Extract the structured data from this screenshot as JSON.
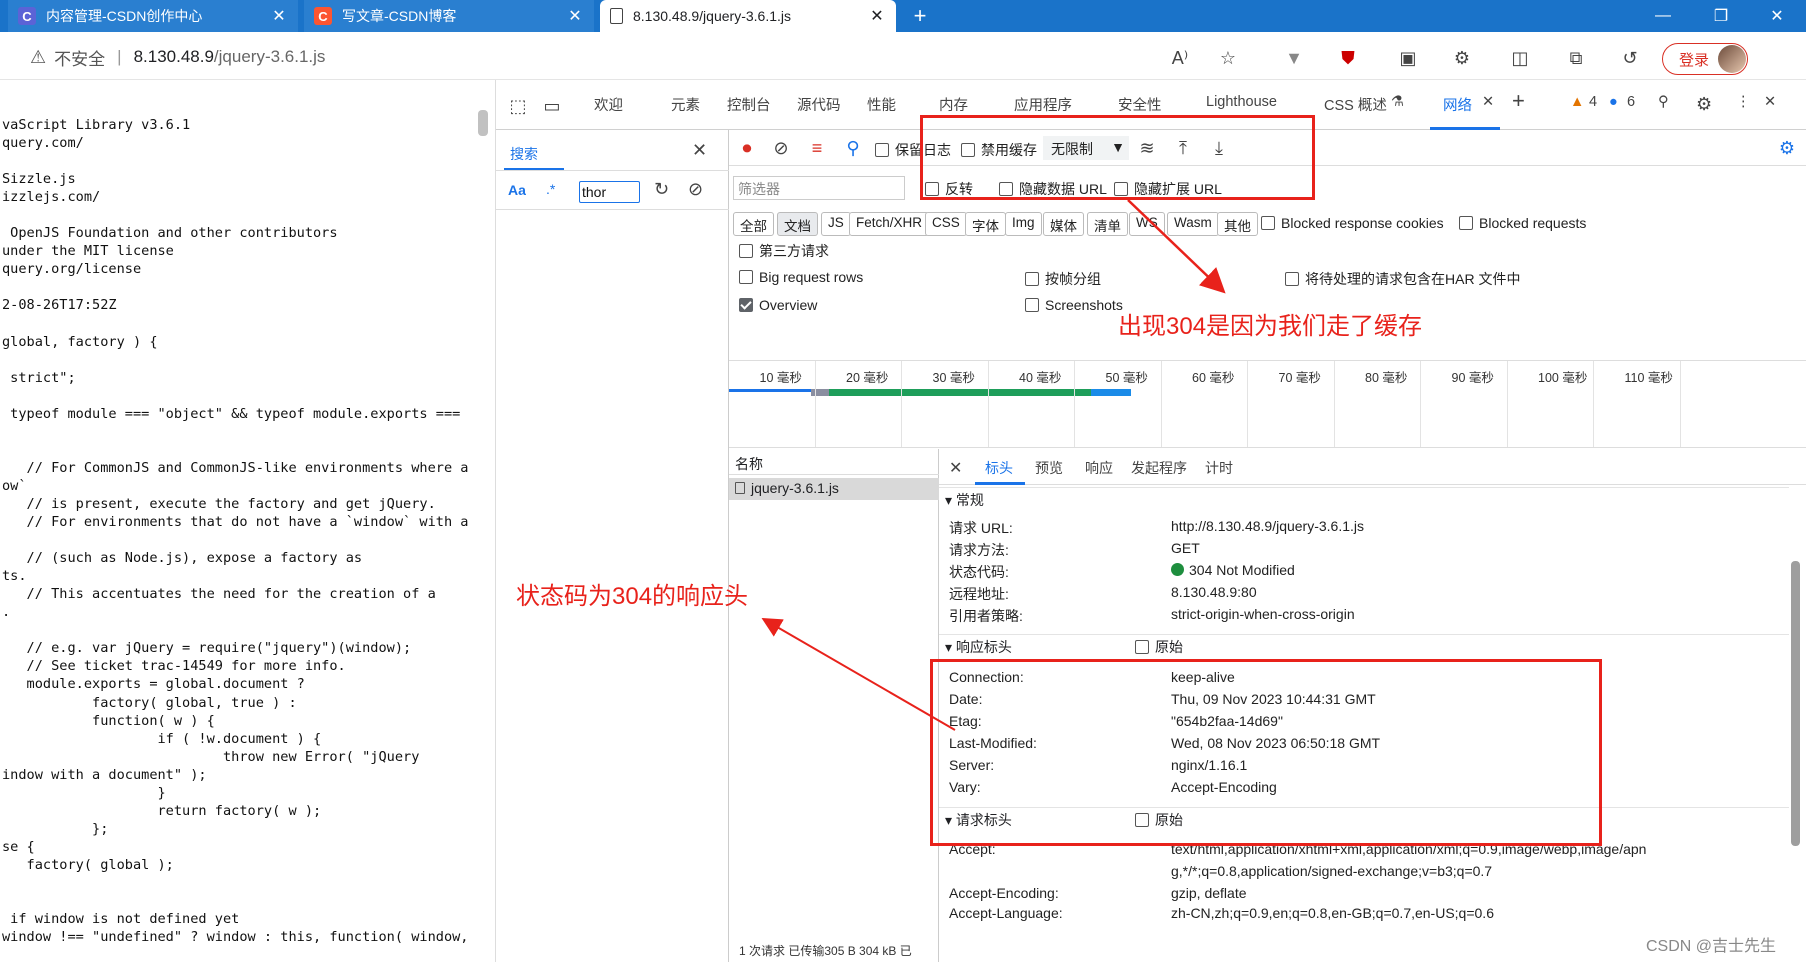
{
  "browser": {
    "tabs": [
      {
        "title": "内容管理-CSDN创作中心",
        "icon_letter": "C",
        "icon_color": "#5b63d6"
      },
      {
        "title": "写文章-CSDN博客",
        "icon_letter": "C",
        "icon_color": "#fc5531"
      },
      {
        "title": "8.130.48.9/jquery-3.6.1.js",
        "icon_letter": "",
        "icon_color": "#ffffff"
      }
    ],
    "new_tab_icon": "plus-icon",
    "address": {
      "security_label": "不安全",
      "host": "8.130.48.9",
      "path": "/jquery-3.6.1.js"
    },
    "login_label": "登录"
  },
  "source_code": {
    "lines": [
      "vaScript Library v3.6.1",
      "query.com/",
      "",
      "Sizzle.js",
      "izzlejs.com/",
      "",
      " OpenJS Foundation and other contributors",
      "under the MIT license",
      "query.org/license",
      "",
      "2-08-26T17:52Z",
      "",
      "global, factory ) {",
      "",
      " strict\";",
      "",
      " typeof module === \"object\" && typeof module.exports ===",
      "",
      "",
      "   // For CommonJS and CommonJS-like environments where a",
      "ow`",
      "   // is present, execute the factory and get jQuery.",
      "   // For environments that do not have a `window` with a",
      "",
      "   // (such as Node.js), expose a factory as",
      "ts.",
      "   // This accentuates the need for the creation of a",
      ".",
      "",
      "   // e.g. var jQuery = require(\"jquery\")(window);",
      "   // See ticket trac-14549 for more info.",
      "   module.exports = global.document ?",
      "           factory( global, true ) :",
      "           function( w ) {",
      "                   if ( !w.document ) {",
      "                           throw new Error( \"jQuery",
      "indow with a document\" );",
      "                   }",
      "                   return factory( w );",
      "           };",
      "se {",
      "   factory( global );",
      "",
      "",
      " if window is not defined yet",
      "window !== \"undefined\" ? window : this, function( window,"
    ]
  },
  "devtools": {
    "tabs": [
      "欢迎",
      "元素",
      "控制台",
      "源代码",
      "性能",
      "内存",
      "应用程序",
      "安全性",
      "Lighthouse",
      "CSS 概述",
      "网络"
    ],
    "warning_count": "4",
    "info_count": "6",
    "search": {
      "tab_label": "搜索",
      "case_label": "Aa",
      "regex_label": ".*",
      "query": "thor"
    },
    "network": {
      "preserve_log": "保留日志",
      "disable_cache": "禁用缓存",
      "throttle": "无限制",
      "filter_placeholder": "筛选器",
      "invert": "反转",
      "hide_data_urls": "隐藏数据 URL",
      "hide_ext_urls": "隐藏扩展 URL",
      "chips": [
        "全部",
        "文档",
        "JS",
        "Fetch/XHR",
        "CSS",
        "字体",
        "Img",
        "媒体",
        "清单",
        "WS",
        "Wasm",
        "其他"
      ],
      "blocked_cookies": "Blocked response cookies",
      "blocked_requests": "Blocked requests",
      "third_party": "第三方请求",
      "big_rows": "Big request rows",
      "group_by_frame": "按帧分组",
      "har_pending": "将待处理的请求包含在HAR 文件中",
      "overview": "Overview",
      "screenshots": "Screenshots",
      "timeline_ticks": [
        "10 毫秒",
        "20 毫秒",
        "30 毫秒",
        "40 毫秒",
        "50 毫秒",
        "60 毫秒",
        "70 毫秒",
        "80 毫秒",
        "90 毫秒",
        "100 毫秒",
        "110 毫秒"
      ],
      "name_header": "名称",
      "request_name": "jquery-3.6.1.js",
      "status_bar": "1 次请求 已传输305 B  304 kB 已",
      "detail_tabs": [
        "标头",
        "预览",
        "响应",
        "发起程序",
        "计时"
      ],
      "general": {
        "title": "常规",
        "rows": [
          {
            "k": "请求 URL:",
            "v": "http://8.130.48.9/jquery-3.6.1.js"
          },
          {
            "k": "请求方法:",
            "v": "GET"
          },
          {
            "k": "状态代码:",
            "v": "304 Not Modified"
          },
          {
            "k": "远程地址:",
            "v": "8.130.48.9:80"
          },
          {
            "k": "引用者策略:",
            "v": "strict-origin-when-cross-origin"
          }
        ]
      },
      "response_headers": {
        "title": "响应标头",
        "raw": "原始",
        "rows": [
          {
            "k": "Connection:",
            "v": "keep-alive"
          },
          {
            "k": "Date:",
            "v": "Thu, 09 Nov 2023 10:44:31 GMT"
          },
          {
            "k": "Etag:",
            "v": "\"654b2faa-14d69\""
          },
          {
            "k": "Last-Modified:",
            "v": "Wed, 08 Nov 2023 06:50:18 GMT"
          },
          {
            "k": "Server:",
            "v": "nginx/1.16.1"
          },
          {
            "k": "Vary:",
            "v": "Accept-Encoding"
          }
        ]
      },
      "request_headers": {
        "title": "请求标头",
        "raw": "原始",
        "rows": [
          {
            "k": "Accept:",
            "v": "text/html,application/xhtml+xml,application/xml;q=0.9,image/webp,image/apn"
          },
          {
            "k": "",
            "v": "g,*/*;q=0.8,application/signed-exchange;v=b3;q=0.7"
          },
          {
            "k": "Accept-Encoding:",
            "v": "gzip, deflate"
          },
          {
            "k": "Accept-Language:",
            "v": "zh-CN,zh;q=0.9,en;q=0.8,en-GB;q=0.7,en-US;q=0.6"
          }
        ]
      }
    }
  },
  "annotations": {
    "cache_note": "出现304是因为我们走了缓存",
    "status_note": "状态码为304的响应头"
  },
  "watermark": "CSDN @吉士先生",
  "colors": {
    "accent": "#1a73e8",
    "annotation": "#e8221b",
    "tabstrip": "#1a73c9",
    "status_ok": "#1e8e3e"
  }
}
